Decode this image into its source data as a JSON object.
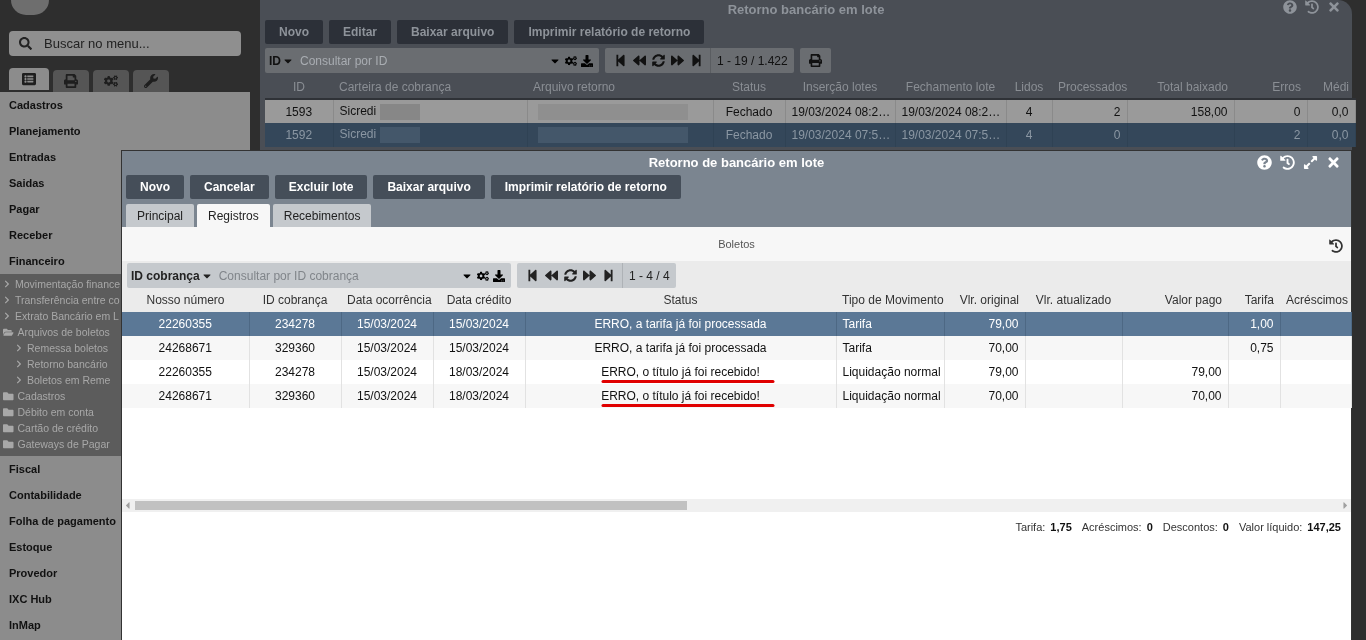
{
  "sidebar": {
    "search_placeholder": "Buscar no menu...",
    "tabs": [
      {
        "kind": "list",
        "selected": true
      },
      {
        "kind": "print",
        "selected": false
      },
      {
        "kind": "cogs",
        "selected": false
      },
      {
        "kind": "wrench",
        "selected": false
      }
    ],
    "menu": [
      {
        "label": "Cadastros"
      },
      {
        "label": "Planejamento"
      },
      {
        "label": "Entradas"
      },
      {
        "label": "Saidas"
      },
      {
        "label": "Pagar"
      },
      {
        "label": "Receber"
      },
      {
        "label": "Financeiro",
        "expanded": true,
        "children": [
          {
            "kind": "link",
            "label": "Movimentação finance"
          },
          {
            "kind": "link",
            "label": "Transferência entre co"
          },
          {
            "kind": "link",
            "label": "Extrato Bancário em L"
          },
          {
            "kind": "folder",
            "label": "Arquivos de boletos",
            "expanded": true,
            "children": [
              {
                "kind": "link",
                "label": "Remessa boletos"
              },
              {
                "kind": "link",
                "label": "Retorno bancário"
              },
              {
                "kind": "link",
                "label": "Boletos em Reme"
              }
            ]
          },
          {
            "kind": "folder",
            "label": "Cadastros",
            "expanded": false
          },
          {
            "kind": "folder",
            "label": "Débito em conta",
            "expanded": false
          },
          {
            "kind": "folder",
            "label": "Cartão de crédito",
            "expanded": false
          },
          {
            "kind": "folder",
            "label": "Gateways de Pagar",
            "expanded": false
          }
        ]
      },
      {
        "label": "Fiscal"
      },
      {
        "label": "Contabilidade"
      },
      {
        "label": "Folha de pagamento"
      },
      {
        "label": "Estoque"
      },
      {
        "label": "Provedor"
      },
      {
        "label": "IXC Hub"
      },
      {
        "label": "InMap"
      }
    ]
  },
  "background_window": {
    "title": "Retorno bancário em lote",
    "buttons": [
      "Novo",
      "Editar",
      "Baixar arquivo",
      "Imprimir relatório de retorno"
    ],
    "search": {
      "field": "ID",
      "placeholder": "Consultar por ID"
    },
    "pagination": "1 - 19 / 1.422",
    "columns": [
      "ID",
      "Carteira de cobrança",
      "Arquivo retorno",
      "Status",
      "Inserção lotes",
      "Fechamento lote",
      "Lidos",
      "Processados",
      "Total baixado",
      "Erros",
      "Médi"
    ],
    "rows": [
      {
        "selected": false,
        "blurred": true,
        "cells": [
          "1593",
          "Sicredi",
          null,
          "Fechado",
          "19/03/2024 08:2…",
          "19/03/2024 08:2…",
          "4",
          "2",
          "158,00",
          "0",
          "0,0"
        ]
      },
      {
        "selected": true,
        "blurred": true,
        "cells": [
          "1592",
          "Sicredi",
          null,
          "Fechado",
          "19/03/2024 07:5…",
          "19/03/2024 07:5…",
          "4",
          "0",
          null,
          "2",
          "0,0"
        ]
      }
    ]
  },
  "dialog": {
    "title": "Retorno de bancário em lote",
    "buttons": [
      "Novo",
      "Cancelar",
      "Excluir lote",
      "Baixar arquivo",
      "Imprimir relatório de retorno"
    ],
    "tabs": [
      {
        "label": "Principal",
        "selected": false
      },
      {
        "label": "Registros",
        "selected": true
      },
      {
        "label": "Recebimentos",
        "selected": false
      }
    ],
    "section_title": "Boletos",
    "search": {
      "field": "ID cobrança",
      "placeholder": "Consultar por ID cobrança"
    },
    "pagination": "1 - 4 / 4",
    "columns": [
      "Nosso número",
      "ID cobrança",
      "Data ocorrência",
      "Data crédito",
      "Status",
      "Tipo de Movimento",
      "Vlr. original",
      "Vlr. atualizado",
      "Valor pago",
      "Tarifa",
      "Acréscimos"
    ],
    "rows": [
      {
        "selected": true,
        "underlined": false,
        "cells": [
          "22260355",
          "234278",
          "15/03/2024",
          "15/03/2024",
          "ERRO, a tarifa já foi processada",
          "Tarifa",
          "79,00",
          null,
          null,
          "1,00",
          null
        ]
      },
      {
        "selected": false,
        "underlined": false,
        "cells": [
          "24268671",
          "329360",
          "15/03/2024",
          "15/03/2024",
          "ERRO, a tarifa já foi processada",
          "Tarifa",
          "70,00",
          null,
          null,
          "0,75",
          null
        ]
      },
      {
        "selected": false,
        "underlined": true,
        "cells": [
          "22260355",
          "234278",
          "15/03/2024",
          "18/03/2024",
          "ERRO, o título já foi recebido!",
          "Liquidação normal",
          "79,00",
          null,
          "79,00",
          null,
          null
        ]
      },
      {
        "selected": false,
        "underlined": true,
        "cells": [
          "24268671",
          "329360",
          "15/03/2024",
          "18/03/2024",
          "ERRO, o título já foi recebido!",
          "Liquidação normal",
          "70,00",
          null,
          "70,00",
          null,
          null
        ]
      }
    ],
    "totals": [
      {
        "label": "Tarifa:",
        "value": "1,75"
      },
      {
        "label": "Acréscimos:",
        "value": "0"
      },
      {
        "label": "Descontos:",
        "value": "0"
      },
      {
        "label": "Valor líquido:",
        "value": "147,25"
      }
    ]
  }
}
